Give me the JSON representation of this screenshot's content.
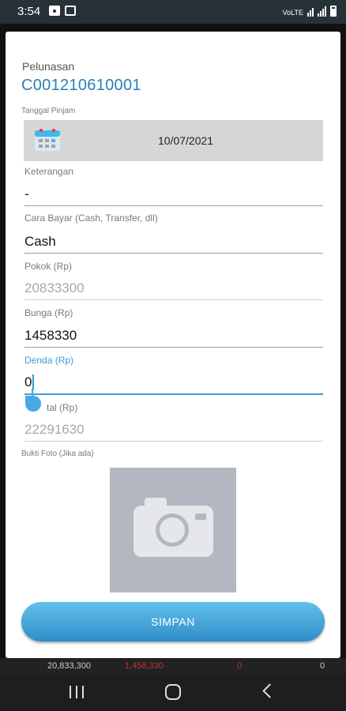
{
  "status_bar": {
    "time": "3:54",
    "network_label": "VoLTE",
    "icons": [
      "image-icon",
      "app-notification-icon",
      "volte-icon",
      "wifi-icon",
      "signal-icon",
      "battery-icon"
    ]
  },
  "dialog": {
    "title": "Pelunasan",
    "code": "C001210610001",
    "tanggal_pinjam": {
      "label": "Tanggal Pinjam",
      "value": "10/07/2021",
      "icon": "calendar-icon"
    },
    "keterangan": {
      "label": "Keterangan",
      "value": "-"
    },
    "cara_bayar": {
      "label": "Cara Bayar (Cash, Transfer, dll)",
      "value": "Cash"
    },
    "pokok": {
      "label": "Pokok (Rp)",
      "value": "20833300"
    },
    "bunga": {
      "label": "Bunga (Rp)",
      "value": "1458330"
    },
    "denda": {
      "label": "Denda (Rp)",
      "value": "0"
    },
    "total": {
      "label": "Total (Rp)",
      "label_visible": "tal (Rp)",
      "value": "22291630"
    },
    "bukti_foto": {
      "label": "Bukti Foto (Jika ada)",
      "icon": "camera-icon"
    },
    "save_label": "SIMPAN"
  },
  "background_row": {
    "pokok": "20,833,300",
    "bunga": "1,458,330",
    "denda": "0",
    "other": "0"
  },
  "colors": {
    "accent": "#2a7fb8",
    "focus": "#3d9ad6",
    "button": "#46a9e3",
    "bunga_red": "#c0392b"
  },
  "nav_bar": {
    "icons": [
      "recent-apps-icon",
      "home-icon",
      "back-icon"
    ]
  }
}
